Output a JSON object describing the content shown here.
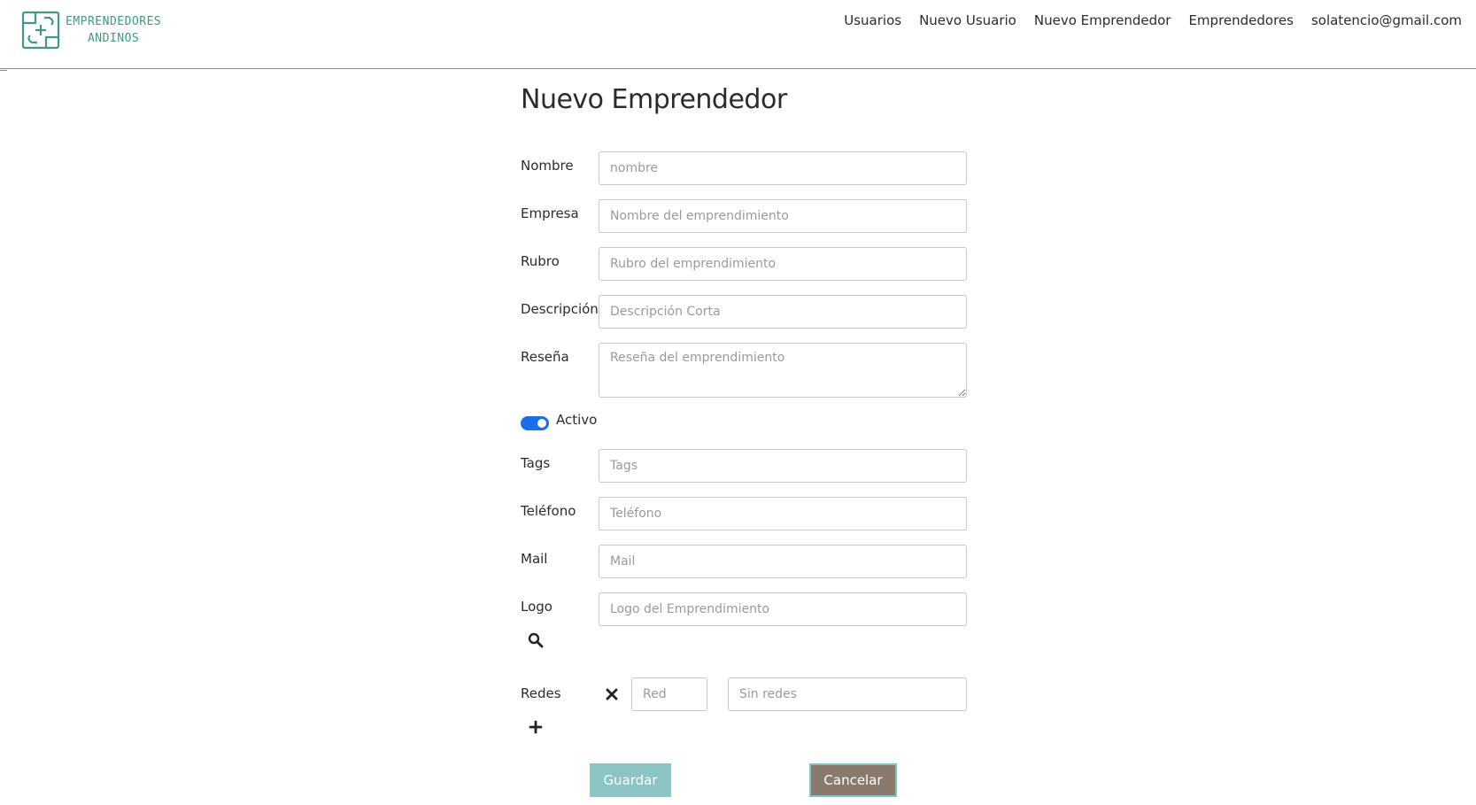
{
  "brand": {
    "line1": "EMPRENDEDORES",
    "line2": "ANDINOS",
    "color": "#3e9a82"
  },
  "nav": {
    "items": [
      {
        "label": "Usuarios"
      },
      {
        "label": "Nuevo Usuario"
      },
      {
        "label": "Nuevo Emprendedor"
      },
      {
        "label": "Emprendedores"
      },
      {
        "label": "solatencio@gmail.com"
      }
    ]
  },
  "page": {
    "title": "Nuevo Emprendedor"
  },
  "form": {
    "nombre": {
      "label": "Nombre",
      "placeholder": "nombre"
    },
    "empresa": {
      "label": "Empresa",
      "placeholder": "Nombre del emprendimiento"
    },
    "rubro": {
      "label": "Rubro",
      "placeholder": "Rubro del emprendimiento"
    },
    "descripcion": {
      "label": "Descripción",
      "placeholder": "Descripción Corta"
    },
    "resena": {
      "label": "Reseña",
      "placeholder": "Reseña del emprendimiento"
    },
    "activo": {
      "label": "Activo",
      "checked": true,
      "color": "#1a6fe8"
    },
    "tags": {
      "label": "Tags",
      "placeholder": "Tags"
    },
    "telefono": {
      "label": "Teléfono",
      "placeholder": "Teléfono"
    },
    "mail": {
      "label": "Mail",
      "placeholder": "Mail"
    },
    "logo": {
      "label": "Logo",
      "placeholder": "Logo del Emprendimiento",
      "icon": "search-icon"
    },
    "redes": {
      "label": "Redes",
      "red_placeholder": "Red",
      "value_placeholder": "Sin redes",
      "remove_icon": "close-icon",
      "add_icon": "plus-icon"
    }
  },
  "actions": {
    "guardar": {
      "label": "Guardar",
      "color": "#8cc3c3"
    },
    "cancelar": {
      "label": "Cancelar",
      "color": "#8a7a6d"
    }
  }
}
